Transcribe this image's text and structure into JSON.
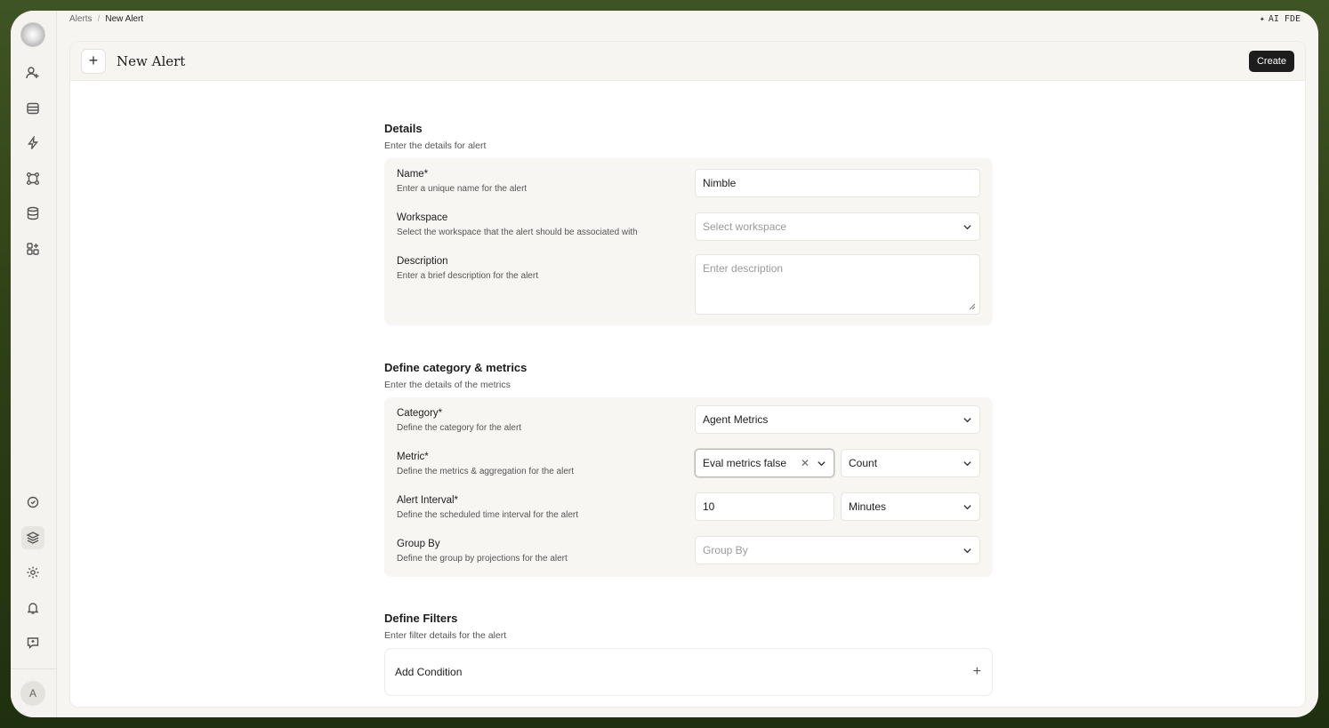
{
  "breadcrumb": {
    "parent": "Alerts",
    "separator": "/",
    "current": "New Alert"
  },
  "topbar": {
    "ai_label": "AI FDE"
  },
  "sidebar": {
    "top_icons": [
      "user-plus-icon",
      "table-icon",
      "lightning-icon",
      "workflow-icon",
      "database-icon",
      "apps-icon"
    ],
    "bottom_icons": [
      "shield-check-icon",
      "layers-icon",
      "settings-icon",
      "bell-icon",
      "feedback-icon"
    ],
    "avatar_initial": "A"
  },
  "header": {
    "title": "New Alert",
    "create_label": "Create"
  },
  "details": {
    "title": "Details",
    "subtitle": "Enter the details for alert",
    "name": {
      "label": "Name*",
      "hint": "Enter a unique name for the alert",
      "value": "Nimble"
    },
    "workspace": {
      "label": "Workspace",
      "hint": "Select the workspace that the alert should be associated with",
      "placeholder": "Select workspace"
    },
    "description": {
      "label": "Description",
      "hint": "Enter a brief description for the alert",
      "placeholder": "Enter description"
    }
  },
  "metrics": {
    "title": "Define category & metrics",
    "subtitle": "Enter the details of the metrics",
    "category": {
      "label": "Category*",
      "hint": "Define the category for the alert",
      "value": "Agent Metrics"
    },
    "metric": {
      "label": "Metric*",
      "hint": "Define the metrics & aggregation for the alert",
      "value": "Eval metrics false",
      "aggregation": "Count"
    },
    "interval": {
      "label": "Alert Interval*",
      "hint": "Define the scheduled time interval for the alert",
      "value": "10",
      "unit": "Minutes"
    },
    "group_by": {
      "label": "Group By",
      "hint": "Define the group by projections for the alert",
      "placeholder": "Group By"
    }
  },
  "filters": {
    "title": "Define Filters",
    "subtitle": "Enter filter details for the alert",
    "add_condition": "Add Condition"
  }
}
